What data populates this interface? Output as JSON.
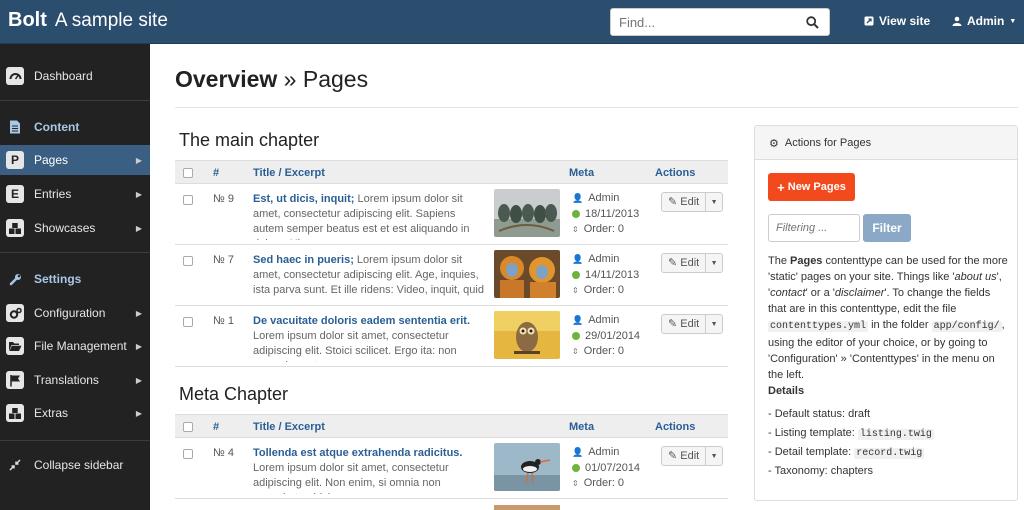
{
  "header": {
    "logo": "Bolt",
    "site_name": "A sample site",
    "search_placeholder": "Find...",
    "view_site": "View site",
    "user": "Admin"
  },
  "sidebar": {
    "dashboard": "Dashboard",
    "content_head": "Content",
    "pages": "Pages",
    "pages_letter": "P",
    "entries": "Entries",
    "entries_letter": "E",
    "showcases": "Showcases",
    "settings_head": "Settings",
    "configuration": "Configuration",
    "file_management": "File Management",
    "translations": "Translations",
    "extras": "Extras",
    "collapse": "Collapse sidebar"
  },
  "page": {
    "title_bold": "Overview",
    "title_rest": " » Pages"
  },
  "columns": {
    "num": "#",
    "title": "Title / Excerpt",
    "meta": "Meta",
    "actions": "Actions"
  },
  "sections": [
    {
      "title": "The main chapter",
      "rows": [
        {
          "num": "№ 9",
          "title": "Est, ut dicis, inquit;",
          "excerpt": " Lorem ipsum dolor sit amet, consectetur adipiscing elit. Sapiens autem semper beatus est et est aliquando in dolore; Hic,",
          "author": "Admin",
          "date": "18/11/2013",
          "order": "Order: 0",
          "edit": "Edit"
        },
        {
          "num": "№ 7",
          "title": "Sed haec in pueris;",
          "excerpt": " Lorem ipsum dolor sit amet, consectetur adipiscing elit. Age, inquies, ista parva sunt. Et ille ridens: Video, inquit, quid ag",
          "author": "Admin",
          "date": "14/11/2013",
          "order": "Order: 0",
          "edit": "Edit"
        },
        {
          "num": "№ 1",
          "title": "De vacuitate doloris eadem sententia erit.",
          "excerpt": " Lorem ipsum dolor sit amet, consectetur adipiscing elit. Stoici scilicet. Ergo ita: non posse honest",
          "author": "Admin",
          "date": "29/01/2014",
          "order": "Order: 0",
          "edit": "Edit"
        }
      ]
    },
    {
      "title": "Meta Chapter",
      "rows": [
        {
          "num": "№ 4",
          "title": "Tollenda est atque extrahenda radicitus.",
          "excerpt": " Lorem ipsum dolor sit amet, consectetur adipiscing elit. Non enim, si omnia non sequebatur, idcirco",
          "author": "Admin",
          "date": "01/07/2014",
          "order": "Order: 0",
          "edit": "Edit"
        }
      ]
    }
  ],
  "panel": {
    "heading": "Actions for Pages",
    "new_button": "New Pages",
    "filter_placeholder": "Filtering ...",
    "filter_button": "Filter",
    "desc": {
      "p1": "The ",
      "b1": "Pages",
      "p2": " contenttype can be used for the more 'static' pages on your site. Things like '",
      "i1": "about us",
      "p3": "', '",
      "i2": "contact",
      "p4": "' or a '",
      "i3": "disclaimer",
      "p5": "'. To change the fields that are in this contenttype, edit the file ",
      "c1": "contenttypes.yml",
      "p6": " in the folder ",
      "c2": "app/config/",
      "p7": ", using the editor of your choice, or by going to 'Configuration' » 'Contenttypes' in the menu on the left."
    },
    "details_heading": "Details",
    "default_status": "- Default status: draft",
    "listing_label": "- Listing template: ",
    "listing_value": "listing.twig",
    "detail_label": "- Detail template: ",
    "detail_value": "record.twig",
    "taxonomy": "- Taxonomy: chapters"
  },
  "colors": {
    "topbar": "#2b4d6e",
    "sidebar": "#222222",
    "accent": "#2a5f96",
    "new_button": "#f24a1d",
    "published": "#6cb33f"
  }
}
